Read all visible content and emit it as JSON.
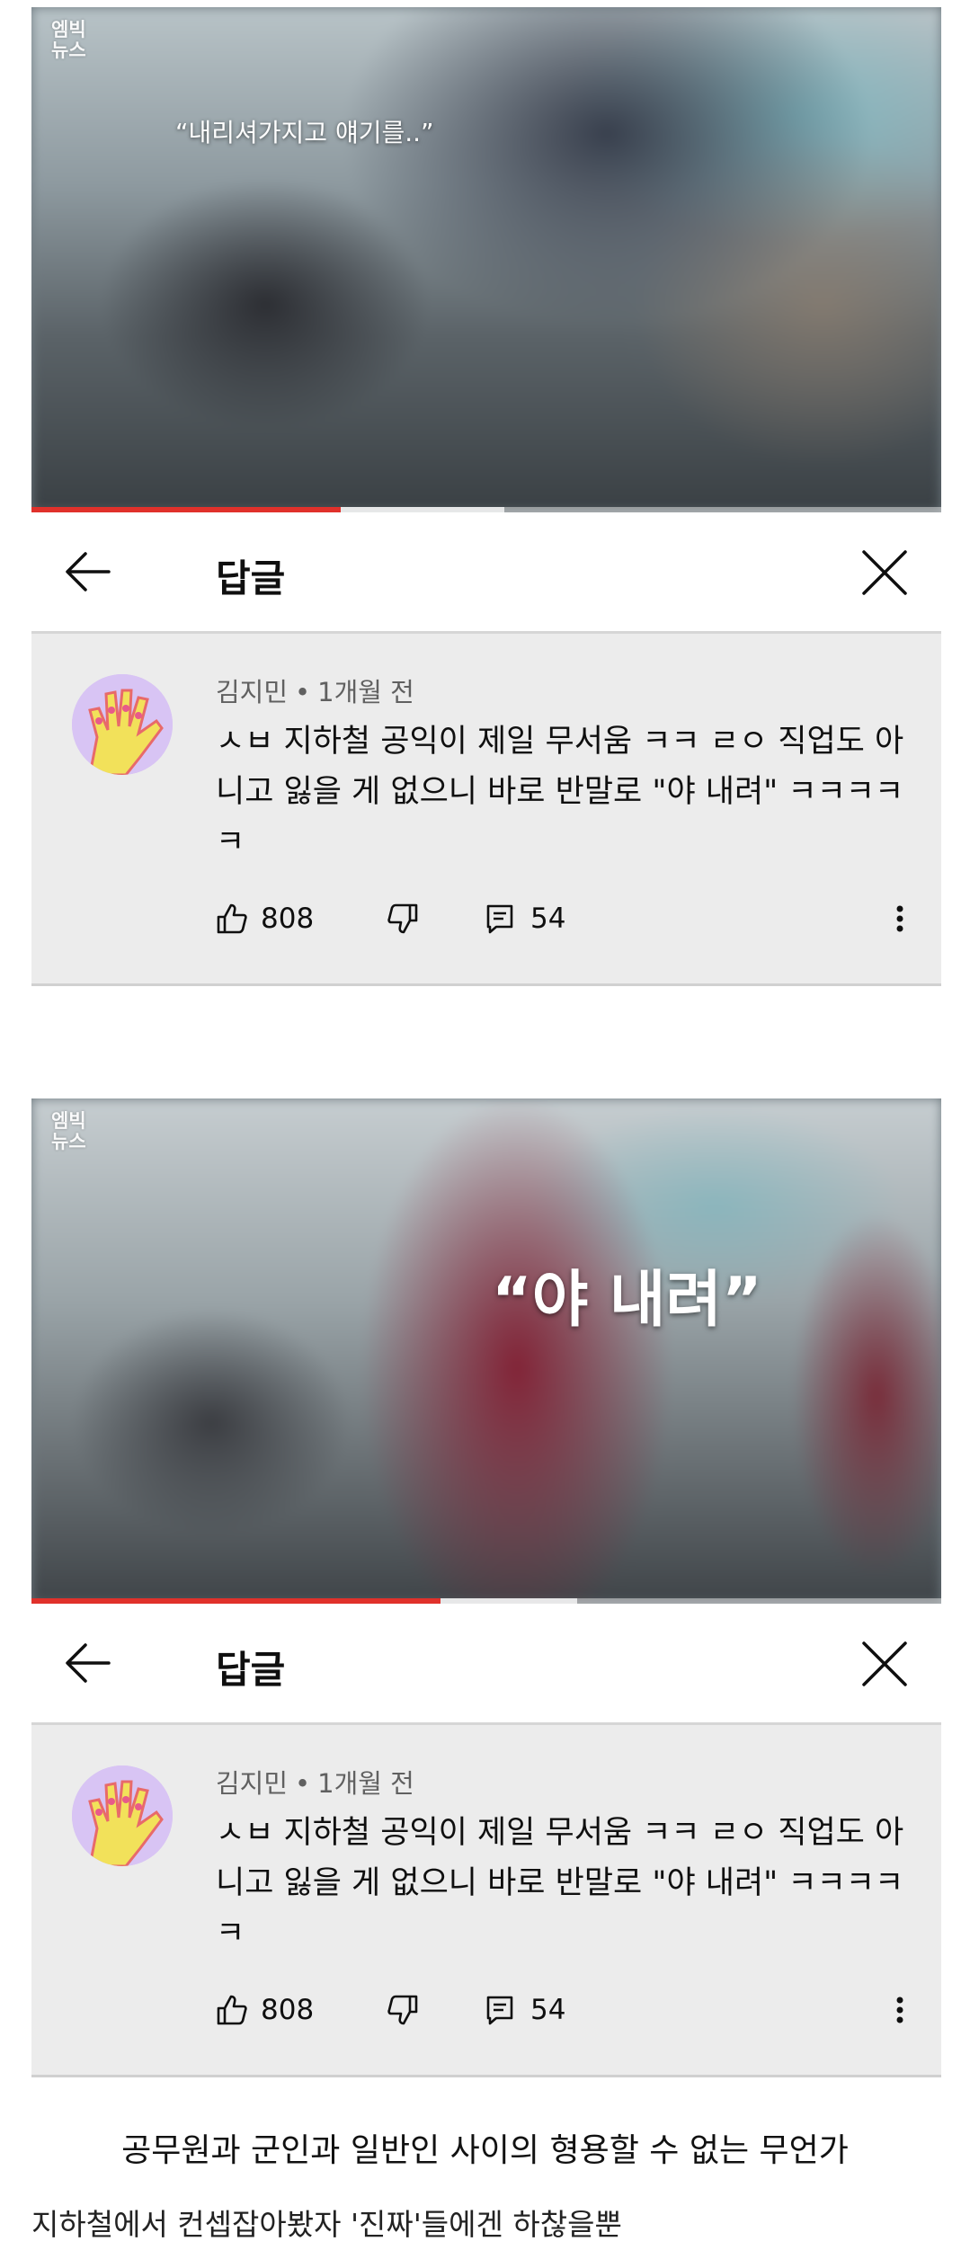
{
  "screens": [
    {
      "video": {
        "logo": "엠빅\n뉴스",
        "caption": "“내리셔가지고 얘기를..”",
        "progress": 0.34,
        "buffered": 0.52
      },
      "header": {
        "title": "답글"
      },
      "comment": {
        "author": "김지민",
        "dot": "•",
        "time": "1개월 전",
        "text": "ㅅㅂ 지하철 공익이 제일 무서움 ㅋㅋ ㄹㅇ 직업도 아니고 잃을 게 없으니 바로 반말로 \"야 내려\" ㅋㅋㅋㅋㅋ",
        "likes": "808",
        "replies": "54"
      }
    },
    {
      "video": {
        "logo": "엠빅\n뉴스",
        "caption": "“야 내려”",
        "progress": 0.45,
        "buffered": 0.6
      },
      "header": {
        "title": "답글"
      },
      "comment": {
        "author": "김지민",
        "dot": "•",
        "time": "1개월 전",
        "text": "ㅅㅂ 지하철 공익이 제일 무서움 ㅋㅋ ㄹㅇ 직업도 아니고 잃을 게 없으니 바로 반말로 \"야 내려\" ㅋㅋㅋㅋㅋ",
        "likes": "808",
        "replies": "54"
      }
    }
  ],
  "footer": {
    "line1": "공무원과 군인과 일반인 사이의 형용할 수 없는 무언가",
    "line2": "지하철에서 컨셉잡아봤자 '진짜'들에겐 하찮을뿐"
  },
  "colors": {
    "progress": "#e0312b",
    "comment_bg": "#ececec",
    "meta": "#606060"
  },
  "icons": [
    "back-arrow-icon",
    "close-icon",
    "thumbs-up-icon",
    "thumbs-down-icon",
    "reply-icon",
    "more-vert-icon"
  ]
}
